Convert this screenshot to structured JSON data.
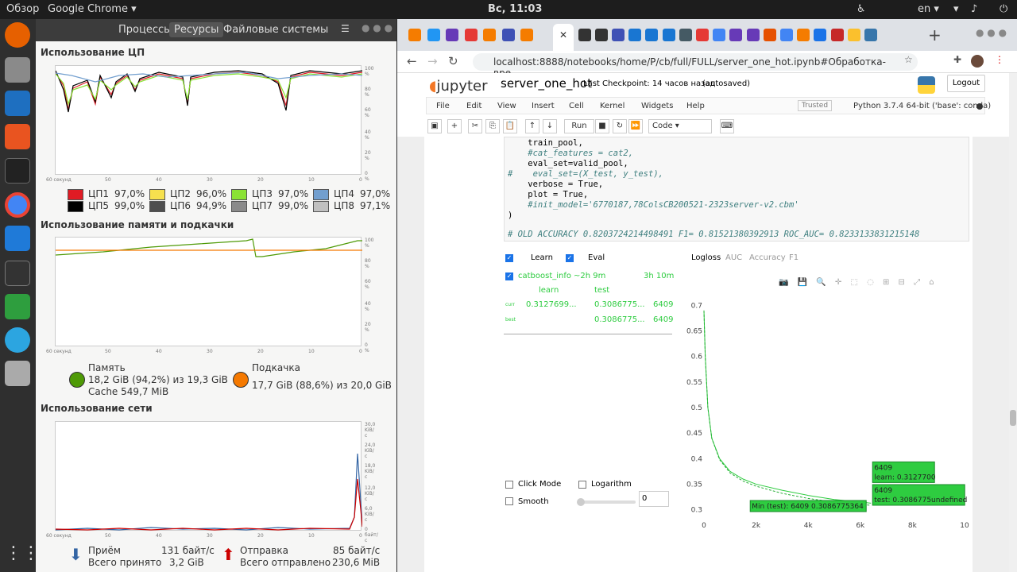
{
  "topbar": {
    "overview": "Обзор",
    "app": "Google Chrome ▾",
    "clock": "Вс, 11:03",
    "lang": "en ▾"
  },
  "sysmon": {
    "tabs": [
      "Процессы",
      "Ресурсы",
      "Файловые системы"
    ],
    "cpu_title": "Использование ЦП",
    "cpu_legend": [
      {
        "name": "ЦП1",
        "value": "97,0%",
        "color": "#e01b24"
      },
      {
        "name": "ЦП2",
        "value": "96,0%",
        "color": "#f6e14e"
      },
      {
        "name": "ЦП3",
        "value": "97,0%",
        "color": "#8ae234"
      },
      {
        "name": "ЦП4",
        "value": "97,0%",
        "color": "#729fcf"
      },
      {
        "name": "ЦП5",
        "value": "99,0%",
        "color": "#000000"
      },
      {
        "name": "ЦП6",
        "value": "94,9%",
        "color": "#4e4e4e"
      },
      {
        "name": "ЦП7",
        "value": "99,0%",
        "color": "#8a8a8a"
      },
      {
        "name": "ЦП8",
        "value": "97,1%",
        "color": "#c0c0c0"
      }
    ],
    "pct_ticks": [
      "100 %",
      "80 %",
      "60 %",
      "40 %",
      "20 %",
      "0 %"
    ],
    "time_ticks": [
      "60 секунд",
      "50",
      "40",
      "30",
      "20",
      "10",
      "0"
    ],
    "mem_title": "Использование памяти и подкачки",
    "mem_label": "Память",
    "mem_value": "18,2 GiB (94,2%) из 19,3 GiB",
    "mem_cache": "Cache 549,7 MiB",
    "swap_label": "Подкачка",
    "swap_value": "17,7 GiB (88,6%) из 20,0 GiB",
    "net_title": "Использование сети",
    "net_ticks": [
      "30,0 KiB/с",
      "24,0 KiB/с",
      "18,0 KiB/с",
      "12,0 KiB/с",
      "6,0 KiB/с",
      "0 байт/с"
    ],
    "recv_label": "Приём",
    "recv_rate": "131 байт/с",
    "recv_total_label": "Всего принято",
    "recv_total": "3,2 GiB",
    "send_label": "Отправка",
    "send_rate": "85 байт/с",
    "send_total_label": "Всего отправлено",
    "send_total": "230,6 MiB"
  },
  "browser": {
    "url": "localhost:8888/notebooks/home/P/cb/full/FULL/server_one_hot.ipynb#Обработка-вре...",
    "jupyter": {
      "logo": "jupyter",
      "name": "server_one_hot",
      "checkpoint": "Last Checkpoint: 14 часов назад",
      "saved": "(autosaved)",
      "logout": "Logout",
      "menu": [
        "File",
        "Edit",
        "View",
        "Insert",
        "Cell",
        "Kernel",
        "Widgets",
        "Help"
      ],
      "trusted": "Trusted",
      "kernel": "Python 3.7.4 64-bit ('base': conda)",
      "run": "Run",
      "celltype": "Code"
    },
    "code": [
      "    train_pool,",
      "    #cat_features = cat2,",
      "    eval_set=valid_pool,",
      "#    eval_set=(X_test, y_test),",
      "    verbose = True,",
      "    plot = True,",
      "    #init_model='6770187,78ColsCB200521-2323server-v2.cbm'",
      ")",
      "",
      "# OLD ACCURACY 0.8203724214498491 F1= 0.81521380392913 ROC_AUC= 0.8233133831215148"
    ],
    "widget": {
      "learn": "Learn",
      "eval": "Eval",
      "run_name": "catboost_info",
      "elapsed": "~2h 9m",
      "remaining": "3h 10m",
      "col_learn": "learn",
      "col_test": "test",
      "row1_label": "curr",
      "row1_learn": "0.3127699...",
      "row1_test": "0.3086775...",
      "row1_iter": "6409",
      "row2_label": "best",
      "row2_test": "0.3086775...",
      "row2_iter": "6409",
      "metric_tabs": [
        "Logloss",
        "AUC",
        "Accuracy",
        "F1"
      ],
      "click_mode": "Click Mode",
      "logarithm": "Logarithm",
      "smooth": "Smooth",
      "smooth_value": "0",
      "tip1_a": "6409",
      "tip1_b": "learn: 0.3127700",
      "tip2_a": "6409",
      "tip2_b": "test: 0.3086775undefined",
      "tip_min": "Min (test): 6409 0.3086775364"
    }
  },
  "chart_data": {
    "type": "line",
    "x_ticks": [
      "0",
      "2k",
      "4k",
      "6k",
      "8k",
      "10"
    ],
    "y_ticks": [
      "0.7",
      "0.65",
      "0.6",
      "0.55",
      "0.5",
      "0.45",
      "0.4",
      "0.35",
      "0.3"
    ],
    "xlim": [
      0,
      10000
    ],
    "ylim": [
      0.29,
      0.71
    ],
    "series": [
      {
        "name": "learn",
        "color": "#2ecc40",
        "x": [
          0,
          50,
          150,
          300,
          600,
          1000,
          1500,
          2000,
          3000,
          4000,
          5000,
          6000,
          6409
        ],
        "y": [
          0.69,
          0.6,
          0.5,
          0.44,
          0.4,
          0.375,
          0.36,
          0.35,
          0.338,
          0.328,
          0.32,
          0.315,
          0.3127
        ]
      },
      {
        "name": "test",
        "color": "#27ae36",
        "x": [
          0,
          50,
          150,
          300,
          600,
          1000,
          1500,
          2000,
          3000,
          4000,
          5000,
          6000,
          6409
        ],
        "y": [
          0.69,
          0.6,
          0.5,
          0.44,
          0.398,
          0.372,
          0.356,
          0.346,
          0.332,
          0.322,
          0.315,
          0.31,
          0.3087
        ]
      }
    ]
  }
}
